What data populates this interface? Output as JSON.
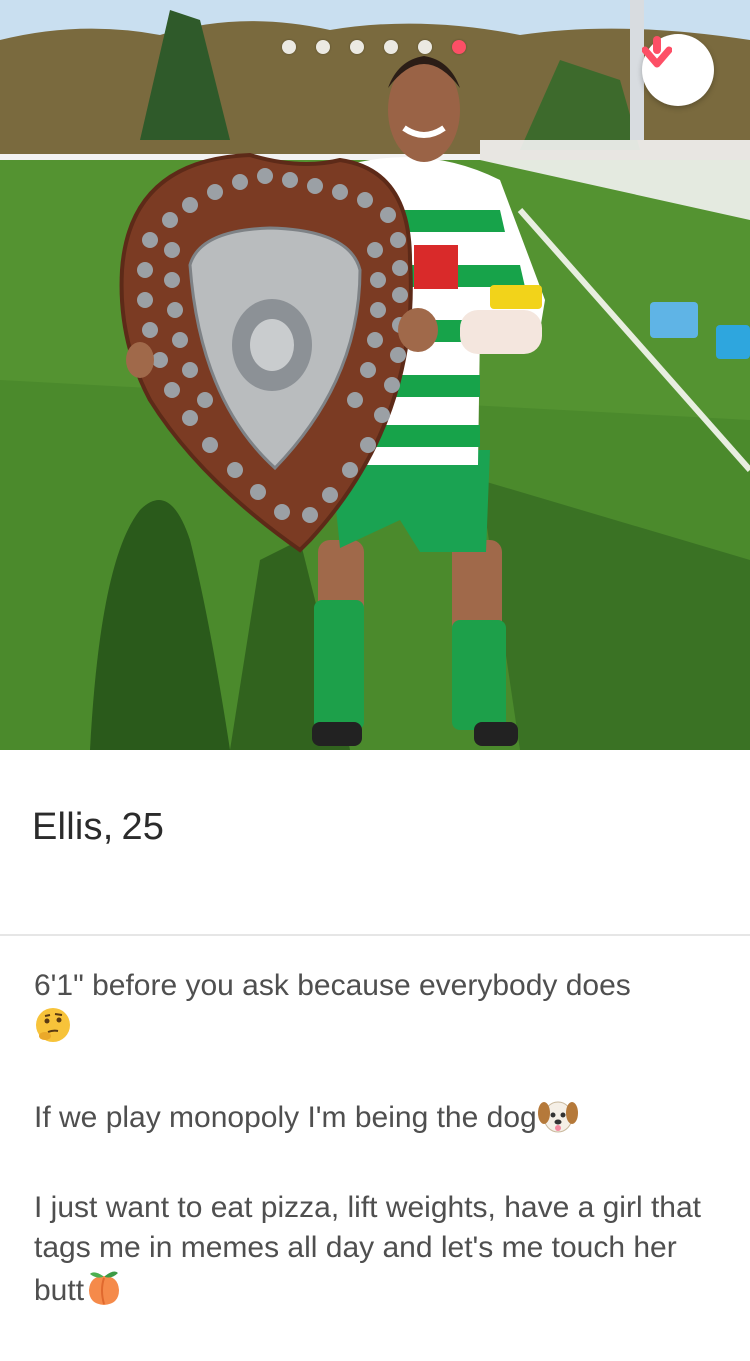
{
  "profile": {
    "name": "Ellis",
    "age": "25",
    "photo_count": 6,
    "active_photo_index": 6
  },
  "bio": {
    "line1": "6'1\" before you ask because everybody does",
    "line1_emoji": "thinking-face",
    "line2": "If we play monopoly I'm being the dog",
    "line2_emoji": "dog-face",
    "line3": "I just want to eat pizza, lift weights, have a girl that tags me in memes all day and let's me touch her butt",
    "line3_emoji": "peach"
  },
  "icons": {
    "collapse": "arrow-down-icon"
  },
  "colors": {
    "accent": "#fd4f66",
    "name_text": "#2b2b2b",
    "bio_text": "#4f4f4f"
  }
}
